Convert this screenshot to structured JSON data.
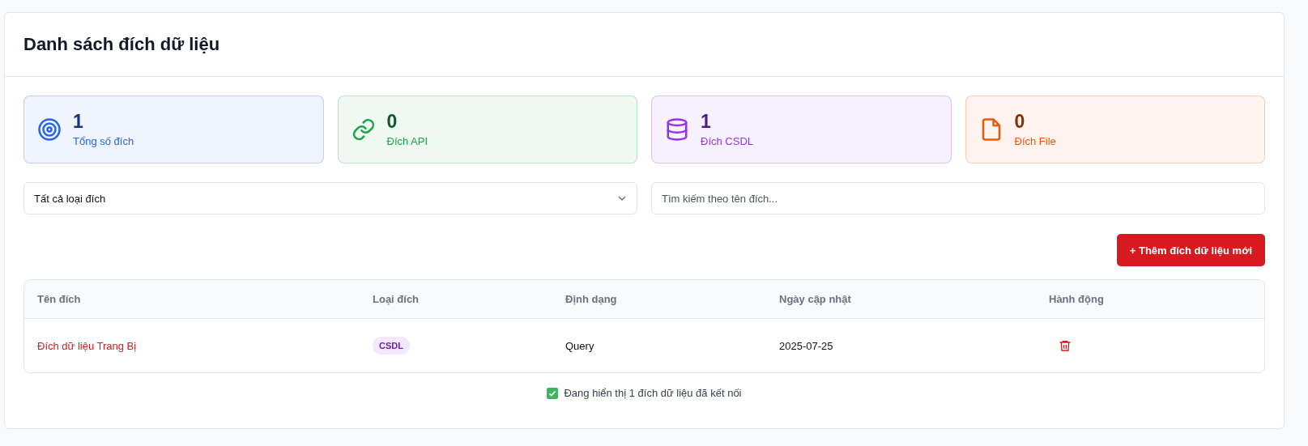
{
  "title": "Danh sách đích dữ liệu",
  "stats": [
    {
      "kind": "target",
      "value": "1",
      "label": "Tổng số đích",
      "color": "#2563eb"
    },
    {
      "kind": "link",
      "value": "0",
      "label": "Đích API",
      "color": "#16a34a"
    },
    {
      "kind": "database",
      "value": "1",
      "label": "Đích CSDL",
      "color": "#9333ea"
    },
    {
      "kind": "file",
      "value": "0",
      "label": "Đích File",
      "color": "#ea580c"
    }
  ],
  "filter": {
    "value": "Tất cả loại đích"
  },
  "search": {
    "placeholder": "Tìm kiếm theo tên đích..."
  },
  "add_button": "+ Thêm đích dữ liệu mới",
  "table": {
    "columns": [
      "Tên đích",
      "Loại đích",
      "Định dạng",
      "Ngày cập nhật",
      "Hành động"
    ],
    "rows": [
      {
        "name": "Đích dữ liệu Trang Bị",
        "type": "CSDL",
        "format": "Query",
        "updated": "2025-07-25"
      }
    ]
  },
  "footer": "Đang hiển thị 1 đích dữ liệu đã kết nối"
}
